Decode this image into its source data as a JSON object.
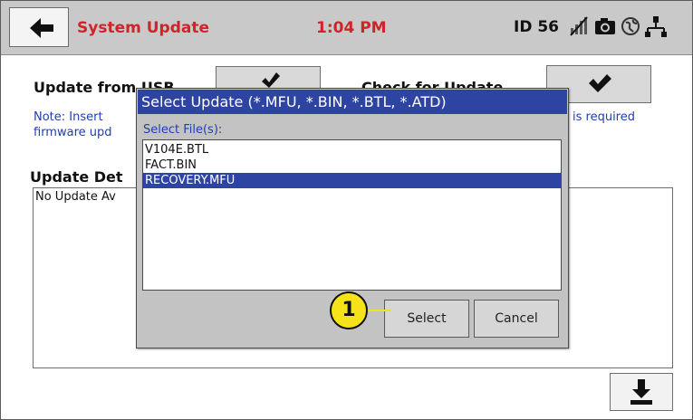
{
  "header": {
    "title": "System Update",
    "time": "1:04 PM",
    "device_id": "ID 56",
    "icons": [
      "back-arrow-icon",
      "no-signal-icon",
      "camera-icon",
      "globe-icon",
      "network-icon"
    ]
  },
  "main": {
    "usb_label": "Update from USB",
    "check_label": "Check for Update",
    "note_line1_left": "Note: Insert",
    "note_line1_right": "is required",
    "note_line2": "firmware upd",
    "details_label": "Update Det",
    "details_text": "No Update Av",
    "icons": [
      "usb-update-icon",
      "checkmark-icon",
      "download-icon"
    ]
  },
  "dialog": {
    "title": "Select Update (*.MFU, *.BIN, *.BTL, *.ATD)",
    "file_label": "Select File(s):",
    "files": [
      {
        "name": "V104E.BTL",
        "selected": false
      },
      {
        "name": "FACT.BIN",
        "selected": false
      },
      {
        "name": "RECOVERY.MFU",
        "selected": true
      }
    ],
    "select_label": "Select",
    "cancel_label": "Cancel"
  },
  "callout": {
    "number": "1",
    "color": "#f5e219"
  },
  "colors": {
    "accent_red": "#d1232a",
    "header_gray": "#c9c9c9",
    "dialog_blue": "#2e44a3",
    "note_blue": "#1f3fb0"
  }
}
